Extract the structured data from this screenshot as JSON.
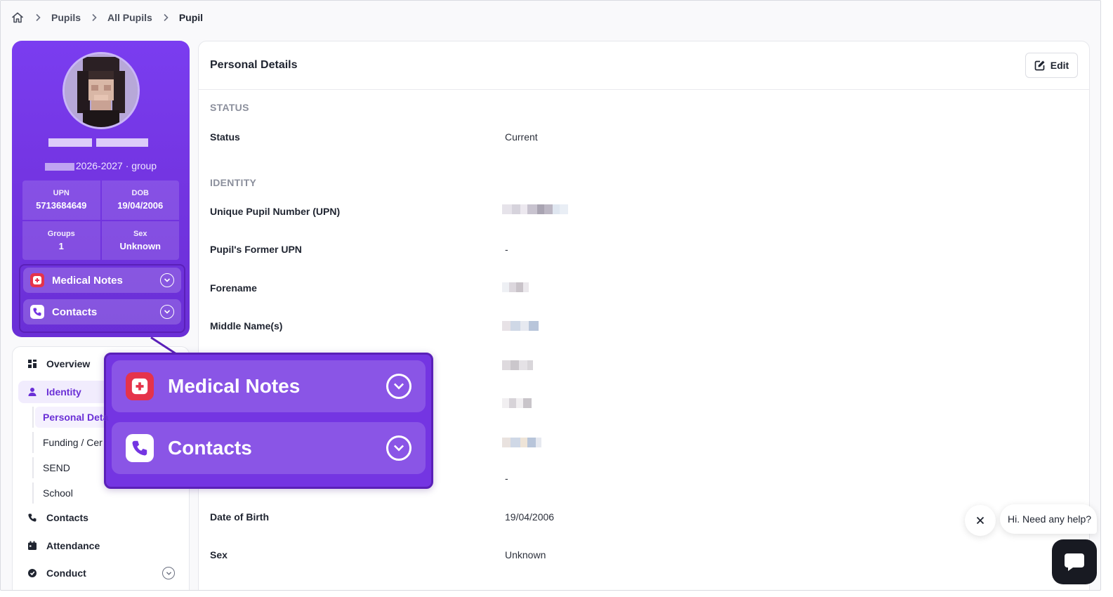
{
  "breadcrumb": {
    "items": [
      "Pupils",
      "All Pupils",
      "Pupil"
    ]
  },
  "profile": {
    "year_group": "2026-2027 · group",
    "stats": [
      {
        "label": "UPN",
        "value": "5713684649"
      },
      {
        "label": "DOB",
        "value": "19/04/2006"
      },
      {
        "label": "Groups",
        "value": "1"
      },
      {
        "label": "Sex",
        "value": "Unknown"
      }
    ],
    "accordions": [
      {
        "label": "Medical Notes",
        "icon": "medical-notes-icon"
      },
      {
        "label": "Contacts",
        "icon": "phone-icon"
      }
    ]
  },
  "nav": {
    "overview": "Overview",
    "identity": "Identity",
    "sub": [
      "Personal Deta",
      "Funding / Cer",
      "SEND",
      "School"
    ],
    "contacts": "Contacts",
    "attendance": "Attendance",
    "conduct": "Conduct"
  },
  "main": {
    "title": "Personal Details",
    "edit_label": "Edit",
    "sections": {
      "status": "STATUS",
      "identity": "IDENTITY"
    },
    "rows": {
      "status_label": "Status",
      "status_value": "Current",
      "upn_label": "Unique Pupil Number (UPN)",
      "former_upn_label": "Pupil's Former UPN",
      "former_upn_value": "-",
      "forename_label": "Forename",
      "middle_label": "Middle Name(s)",
      "dash_value": "-",
      "dob_label": "Date of Birth",
      "dob_value": "19/04/2006",
      "sex_label": "Sex",
      "sex_value": "Unknown"
    }
  },
  "zoom": {
    "items": [
      "Medical Notes",
      "Contacts"
    ]
  },
  "chat": {
    "message": "Hi. Need any help?"
  },
  "colors": {
    "accent": "#7435e2",
    "accent_dark": "#5a20b8",
    "medical_red": "#e5334b"
  }
}
